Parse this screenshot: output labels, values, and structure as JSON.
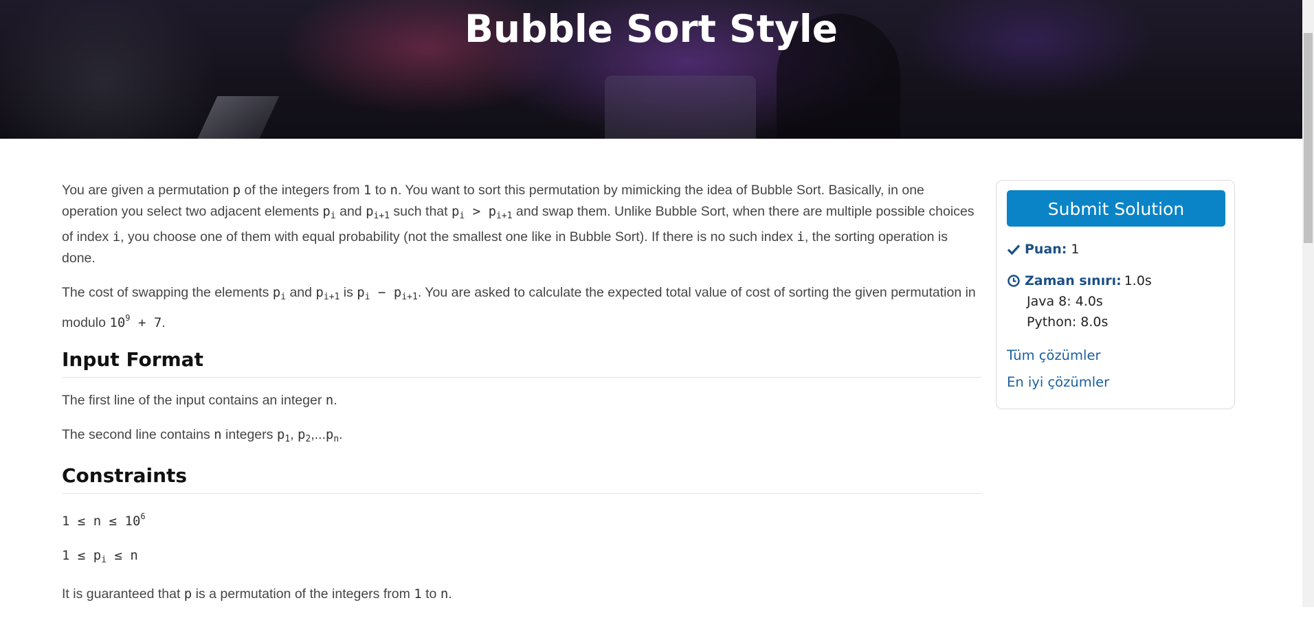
{
  "hero": {
    "title": "Bubble Sort Style"
  },
  "statement": {
    "p1": {
      "t1": "You are given a permutation ",
      "m_p": "p",
      "t2": " of the integers from ",
      "m_1": "1",
      "t3": " to ",
      "m_n": "n",
      "t4": ". You want to sort this permutation by mimicking the idea of Bubble Sort. Basically, in one operation you select two adjacent elements ",
      "pi": "p",
      "pi_sub": "i",
      "t5": " and ",
      "pi1": "p",
      "pi1_sub": "i+1",
      "t6": " such that ",
      "cmp_a": "p",
      "cmp_a_sub": "i",
      "cmp_op": " > ",
      "cmp_b": "p",
      "cmp_b_sub": "i+1",
      "t7": " and swap them. Unlike Bubble Sort, when there are multiple possible choices of index ",
      "m_i": "i",
      "t8": ", you choose one of them with equal probability (not the smallest one like in Bubble Sort). If there is no such index ",
      "m_i2": "i",
      "t9": ", the sorting operation is done."
    },
    "p2": {
      "t1": "The cost of swapping the elements ",
      "a": "p",
      "a_sub": "i",
      "t2": " and ",
      "b": "p",
      "b_sub": "i+1",
      "t3": " is ",
      "c": "p",
      "c_sub": "i",
      "minus": " − ",
      "d": "p",
      "d_sub": "i+1",
      "t4": ". You are asked to calculate the expected total value of cost of sorting the given permutation in modulo ",
      "mod_base": "10",
      "mod_exp": "9",
      "mod_rest": " + 7",
      "t5": "."
    },
    "input_format": {
      "heading": "Input Format",
      "l1_t1": "The first line of the input contains an integer ",
      "l1_m": "n",
      "l1_t2": ".",
      "l2_t1": "The second line contains ",
      "l2_m": "n",
      "l2_t2": " integers ",
      "l2_p1": "p",
      "l2_p1_sub": "1",
      "l2_comma": ", ",
      "l2_p2": "p",
      "l2_p2_sub": "2",
      "l2_dots": ",...",
      "l2_pn": "p",
      "l2_pn_sub": "n",
      "l2_end": "."
    },
    "constraints": {
      "heading": "Constraints",
      "c1_a": "1 ≤ n ≤ 10",
      "c1_exp": "6",
      "c2_a": "1 ≤ ",
      "c2_p": "p",
      "c2_sub": "i",
      "c2_b": " ≤ n",
      "c3_t1": "It is guaranteed that ",
      "c3_m": "p",
      "c3_t2": " is a permutation of the integers from ",
      "c3_m1": "1",
      "c3_t3": " to ",
      "c3_mn": "n",
      "c3_t4": "."
    }
  },
  "sidebar": {
    "submit_label": "Submit Solution",
    "score_label": "Puan:",
    "score_value": "1",
    "time_label": "Zaman sınırı:",
    "time_value": "1.0s",
    "java_limit": "Java 8: 4.0s",
    "python_limit": "Python: 8.0s",
    "all_solutions": "Tüm çözümler",
    "best_solutions": "En iyi çözümler",
    "icons": {
      "score": "check-icon",
      "time": "clock-icon"
    }
  },
  "colors": {
    "accent": "#0a84c6",
    "link": "#1a5f9e",
    "label": "#1a4f86"
  }
}
